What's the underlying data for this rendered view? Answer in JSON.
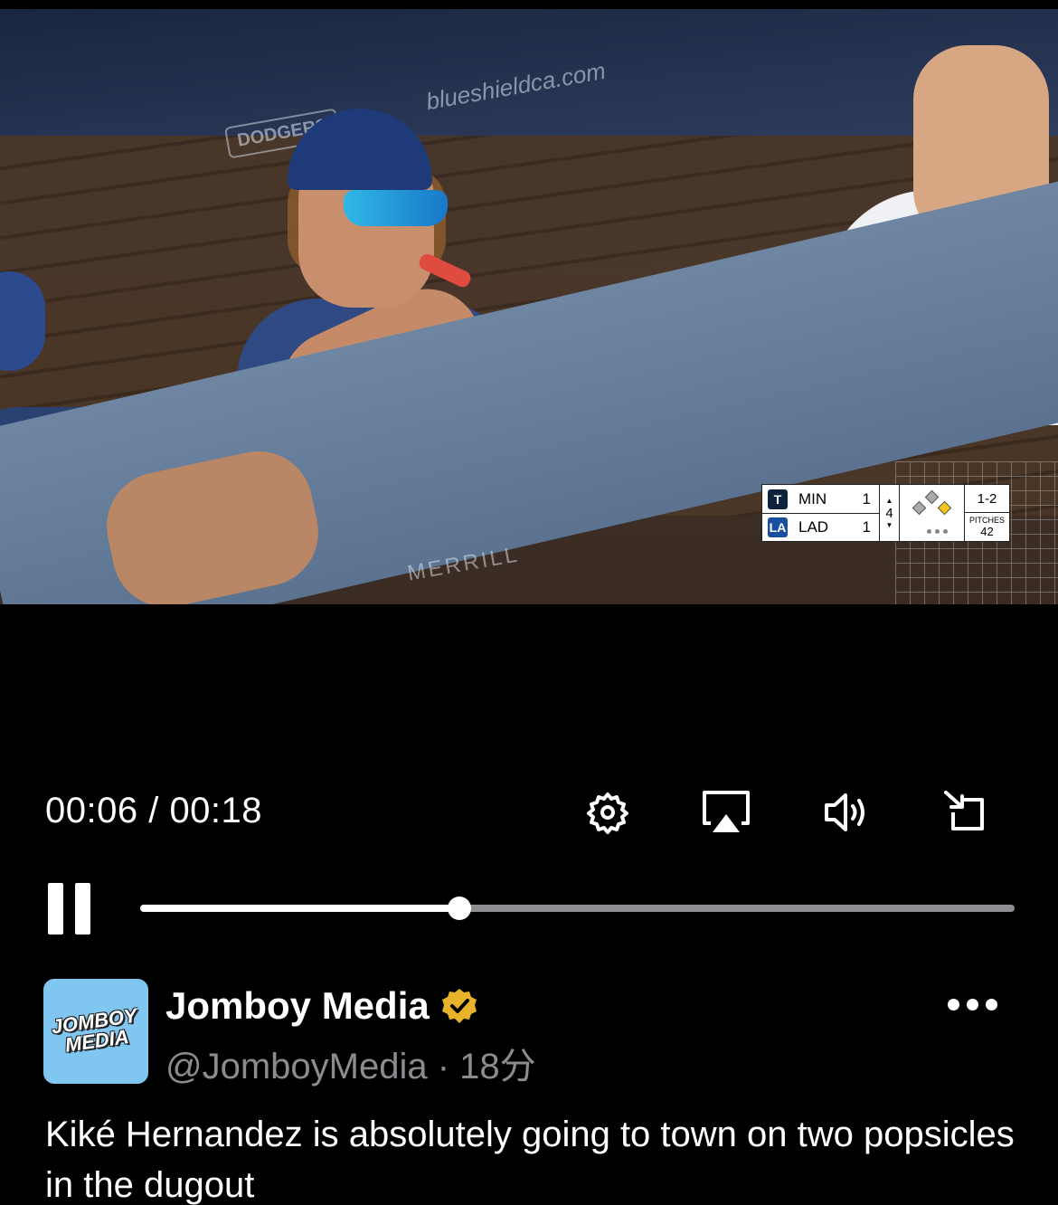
{
  "video": {
    "watermark_site": "blueshieldca.com",
    "watermark_dodgers": "DODGERS",
    "watermark_merrill": "MERRILL",
    "scorebug": {
      "away": {
        "abbr": "MIN",
        "score": "1",
        "logo": "T"
      },
      "home": {
        "abbr": "LAD",
        "score": "1",
        "logo": "LA"
      },
      "inning": "4",
      "count": "1-2",
      "pitches_label": "PITCHES",
      "pitches": "42",
      "runner_on": "first"
    }
  },
  "player_controls": {
    "elapsed": "00:06",
    "total": "00:18",
    "time_display": "00:06 / 00:18",
    "progress_fraction": 0.365,
    "state": "playing",
    "icons": [
      "settings-gear-icon",
      "airplay-icon",
      "volume-icon",
      "exit-fullscreen-icon",
      "pause-icon"
    ]
  },
  "post": {
    "avatar_text_line1": "JOMBOY",
    "avatar_text_line2": "MEDIA",
    "author_name": "Jomboy Media",
    "verified_color": "#e8b32a",
    "handle_time": "@JomboyMedia · 18分",
    "text": "Kiké Hernandez is absolutely going to town on two popsicles in the dugout"
  },
  "colors": {
    "avatar_bg": "#7fc6f1",
    "handle_gray": "#8b8b90",
    "progress_track": "#8e8e93"
  }
}
